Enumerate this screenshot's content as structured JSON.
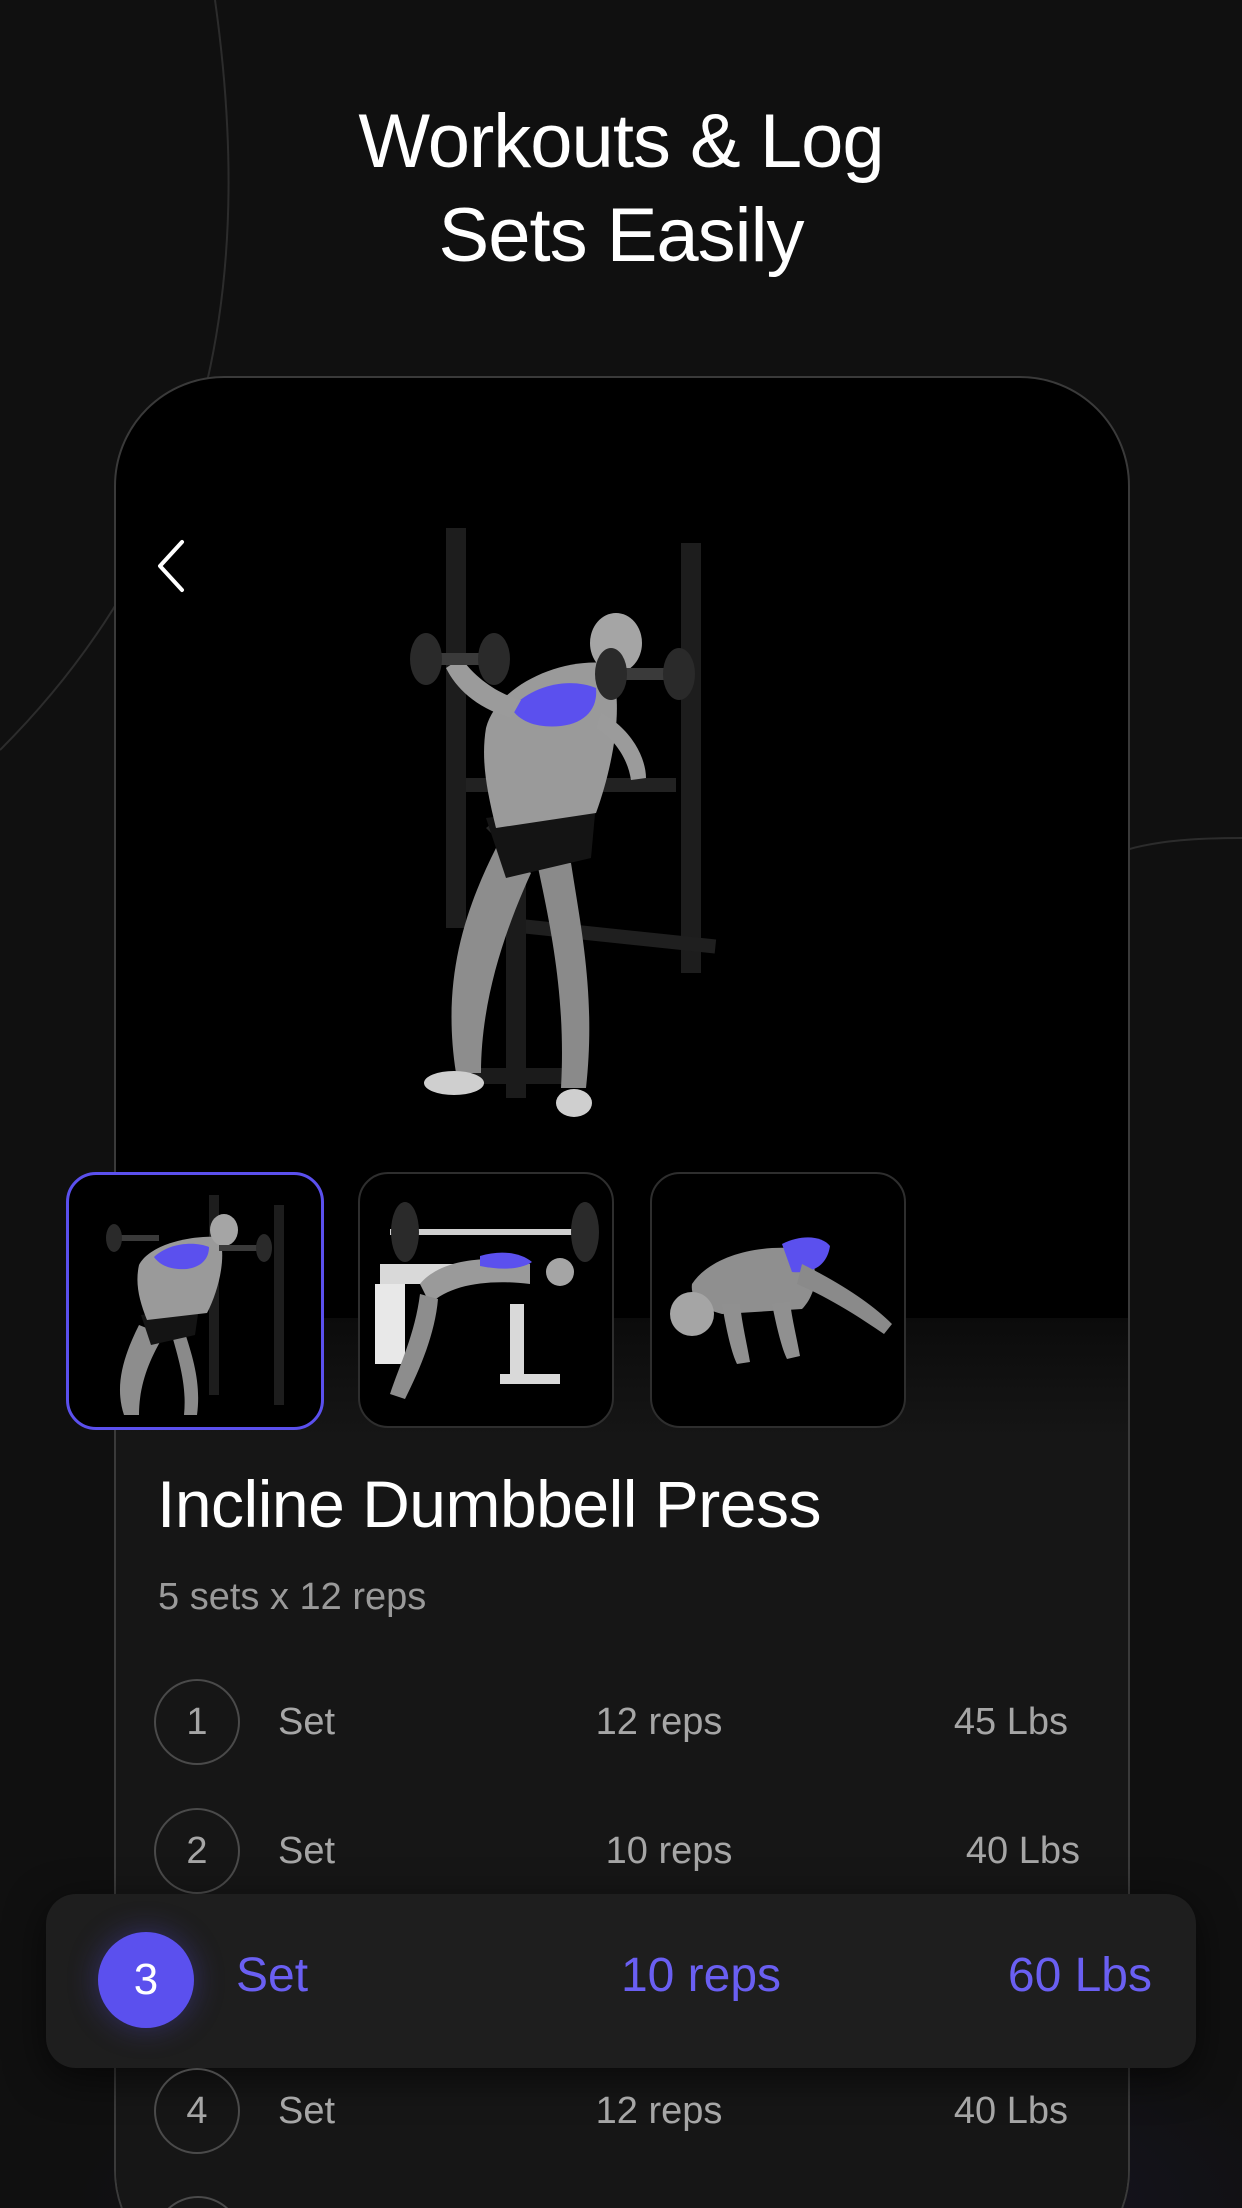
{
  "headline": {
    "line1": "Workouts & Log",
    "line2": "Sets Easily"
  },
  "colors": {
    "background": "#101010",
    "accent": "#5b50ee",
    "muscle_highlight": "#5b50ee",
    "text_primary": "#ffffff",
    "text_secondary": "#a6a6a6"
  },
  "icons": {
    "back": "chevron-left-icon"
  },
  "thumbnails": [
    {
      "name": "incline-dumbbell-press",
      "selected": true
    },
    {
      "name": "bench-press",
      "selected": false
    },
    {
      "name": "push-up",
      "selected": false
    }
  ],
  "exercise": {
    "title": "Incline Dumbbell Press",
    "subtitle": "5 sets x 12 reps"
  },
  "sets": [
    {
      "number": "1",
      "label": "Set",
      "reps": "12 reps",
      "weight": "45 Lbs"
    },
    {
      "number": "2",
      "label": "Set",
      "reps": "10 reps",
      "weight": "40 Lbs"
    },
    {
      "number": "3",
      "label": "Set",
      "reps": "10 reps",
      "weight": "60 Lbs"
    },
    {
      "number": "4",
      "label": "Set",
      "reps": "12 reps",
      "weight": "40 Lbs"
    }
  ],
  "active_set_index": 2
}
